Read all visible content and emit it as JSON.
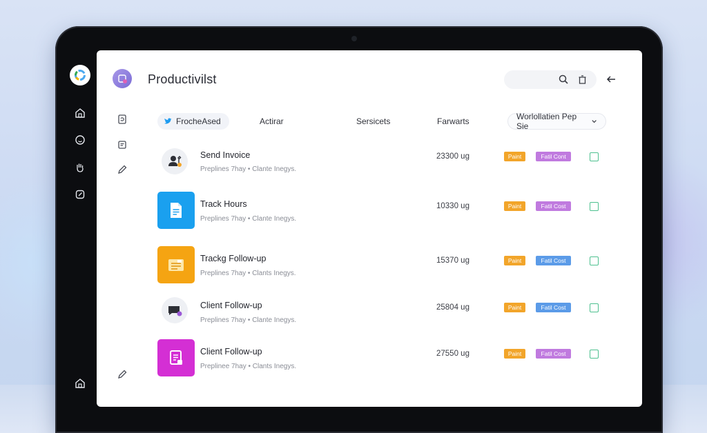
{
  "app": {
    "title": "Productivilst"
  },
  "header": {
    "search_icon": "search-icon",
    "trash_icon": "trash-icon",
    "back_icon": "back-arrow-icon"
  },
  "tabs": [
    {
      "label": "FrocheAsed",
      "icon": "twitter-bird-icon",
      "active": true
    },
    {
      "label": "Actirar"
    },
    {
      "label": "Sersicets"
    },
    {
      "label": "Farwarts"
    }
  ],
  "dropdown": {
    "label": "Worlollatien Pep Sie",
    "icon": "chevron-down-icon"
  },
  "rows": [
    {
      "title": "Send Invoice",
      "subtitle": "Preplines 7hay • Clante Inegys.",
      "amount": "23300 ug",
      "tag1": "Paint",
      "tag2": "Fatil Cont",
      "tag2_color": "#c07adf",
      "icon": "user-pen-icon"
    },
    {
      "title": "Track Hours",
      "subtitle": "Preplines 7hay • Clante Inegys.",
      "amount": "10330 ug",
      "tag1": "Paint",
      "tag2": "Fatil Cost",
      "tag2_color": "#c07adf",
      "icon": "document-icon"
    },
    {
      "title": "Trackg Follow-up",
      "subtitle": "Preplines 7hay • Clants Inegys.",
      "amount": "15370 ug",
      "tag1": "Paint",
      "tag2": "Fatil Cost",
      "tag2_color": "#5b9be8",
      "icon": "folder-icon"
    },
    {
      "title": "Client Follow-up",
      "subtitle": "Preplines 7hay • Clante Inegys.",
      "amount": "25804 ug",
      "tag1": "Paint",
      "tag2": "Fatil Cost",
      "tag2_color": "#5b9be8",
      "icon": "chat-icon"
    },
    {
      "title": "Client Follow-up",
      "subtitle": "Preplinee 7hay • Clants Inegys.",
      "amount": "27550 ug",
      "tag1": "Paint",
      "tag2": "Fatil Cost",
      "tag2_color": "#c07adf",
      "icon": "clipboard-icon"
    }
  ],
  "colors": {
    "tag1": "#f2a52a",
    "checkbox": "#4cc08e",
    "icon_blue": "#1aa0ef",
    "icon_orange": "#f5a412",
    "icon_magenta": "#d42fd4"
  }
}
